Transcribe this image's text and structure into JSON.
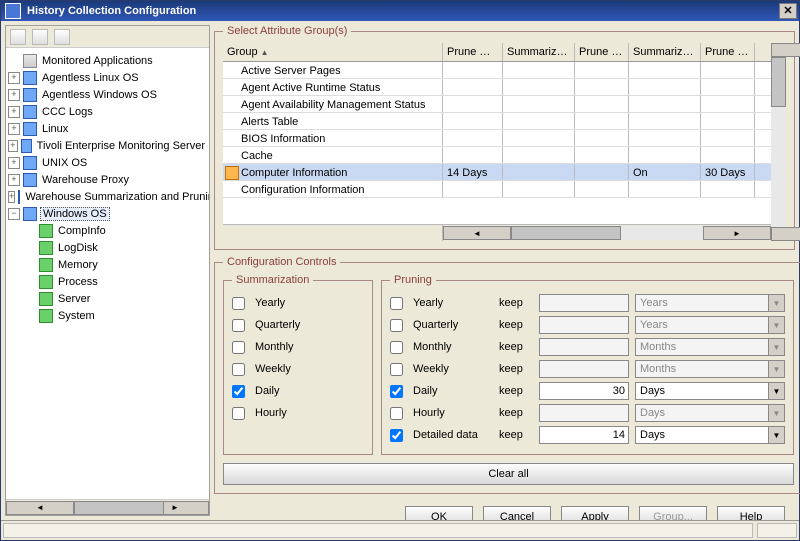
{
  "window": {
    "title": "History Collection Configuration"
  },
  "toolbar_icons": [
    "book-icon",
    "refresh-icon",
    "save-icon"
  ],
  "tree": {
    "root": "Monitored Applications",
    "items": [
      {
        "label": "Agentless Linux OS",
        "exp": "+",
        "icon": "blue"
      },
      {
        "label": "Agentless Windows OS",
        "exp": "+",
        "icon": "blue"
      },
      {
        "label": "CCC Logs",
        "exp": "+",
        "icon": "blue"
      },
      {
        "label": "Linux",
        "exp": "+",
        "icon": "blue"
      },
      {
        "label": "Tivoli Enterprise Monitoring Server",
        "exp": "+",
        "icon": "blue"
      },
      {
        "label": "UNIX OS",
        "exp": "+",
        "icon": "blue"
      },
      {
        "label": "Warehouse Proxy",
        "exp": "+",
        "icon": "blue"
      },
      {
        "label": "Warehouse Summarization and Pruning Agent",
        "exp": "+",
        "icon": "blue"
      },
      {
        "label": "Windows OS",
        "exp": "-",
        "icon": "blue",
        "selected": true
      }
    ],
    "children": [
      {
        "label": "CompInfo",
        "icon": "green"
      },
      {
        "label": "LogDisk",
        "icon": "green"
      },
      {
        "label": "Memory",
        "icon": "green"
      },
      {
        "label": "Process",
        "icon": "green"
      },
      {
        "label": "Server",
        "icon": "green"
      },
      {
        "label": "System",
        "icon": "green"
      }
    ]
  },
  "groups": {
    "legend": "Select Attribute Group(s)",
    "headers": {
      "group": "Group",
      "pd": "Prune Detailed",
      "sh": "Summarize Hourly",
      "ph": "Prune Hourly",
      "sd": "Summarize Daily",
      "pD": "Prune Daily"
    },
    "rows": [
      {
        "name": "Active Server Pages"
      },
      {
        "name": "Agent Active Runtime Status"
      },
      {
        "name": "Agent Availability Management Status"
      },
      {
        "name": "Alerts Table"
      },
      {
        "name": "BIOS Information"
      },
      {
        "name": "Cache"
      },
      {
        "name": "Computer Information",
        "sel": true,
        "pd": "14 Days",
        "sd": "On",
        "pD": "30 Days"
      },
      {
        "name": "Configuration Information"
      }
    ]
  },
  "config": {
    "legend": "Configuration Controls",
    "summ": {
      "legend": "Summarization",
      "items": [
        "Yearly",
        "Quarterly",
        "Monthly",
        "Weekly",
        "Daily",
        "Hourly"
      ],
      "checked": [
        "Daily"
      ]
    },
    "prun": {
      "legend": "Pruning",
      "keep_label": "keep",
      "rows": [
        {
          "label": "Yearly",
          "checked": false,
          "unit": "Years",
          "value": "",
          "enabled": false
        },
        {
          "label": "Quarterly",
          "checked": false,
          "unit": "Years",
          "value": "",
          "enabled": false
        },
        {
          "label": "Monthly",
          "checked": false,
          "unit": "Months",
          "value": "",
          "enabled": false
        },
        {
          "label": "Weekly",
          "checked": false,
          "unit": "Months",
          "value": "",
          "enabled": false
        },
        {
          "label": "Daily",
          "checked": true,
          "unit": "Days",
          "value": "30",
          "enabled": true
        },
        {
          "label": "Hourly",
          "checked": false,
          "unit": "Days",
          "value": "",
          "enabled": false
        },
        {
          "label": "Detailed data",
          "checked": true,
          "unit": "Days",
          "value": "14",
          "enabled": true
        }
      ]
    },
    "clear_all": "Clear all"
  },
  "buttons": {
    "ok_u": "O",
    "ok_rest": "K",
    "cancel": "Cancel",
    "apply": "Apply",
    "group_u": "G",
    "group_rest": "roup...",
    "help": "Help"
  }
}
